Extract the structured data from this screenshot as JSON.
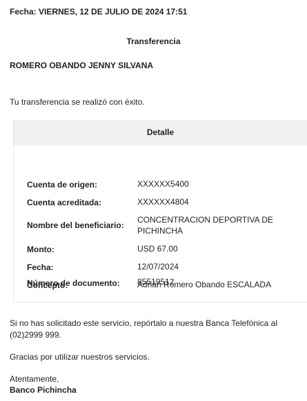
{
  "header": {
    "fecha": "Fecha: VIERNES, 12 DE JULIO DE 2024 17:51",
    "title": "Transferencia",
    "recipient": "ROMERO OBANDO JENNY SILVANA",
    "message": "Tu transferencia se realizó con éxito."
  },
  "detail": {
    "title": "Detalle",
    "rows": [
      {
        "label": "Cuenta de origen:",
        "value": "XXXXXX5400"
      },
      {
        "label": "Cuenta acreditada:",
        "value": "XXXXXX4804"
      },
      {
        "label": "Nombre del beneficiario:",
        "value": "CONCENTRACION DEPORTIVA DE PICHINCHA"
      },
      {
        "label": "Monto:",
        "value": "USD 67.00"
      },
      {
        "label": "Fecha:",
        "value": "12/07/2024"
      },
      {
        "label": "Concepto:",
        "value": "Adrián Romero Obando ESCALADA"
      },
      {
        "label": "Número de documento:",
        "value": "85519512"
      }
    ]
  },
  "footer": {
    "notice_line1": "Si no has solicitado este servicio, repórtalo a nuestra Banca Telefónica al",
    "notice_line2": "(02)2999 999.",
    "thanks": "Gracias por utilizar nuestros servicios.",
    "closing": "Atentamente,",
    "signature": "Banco Pichincha"
  }
}
